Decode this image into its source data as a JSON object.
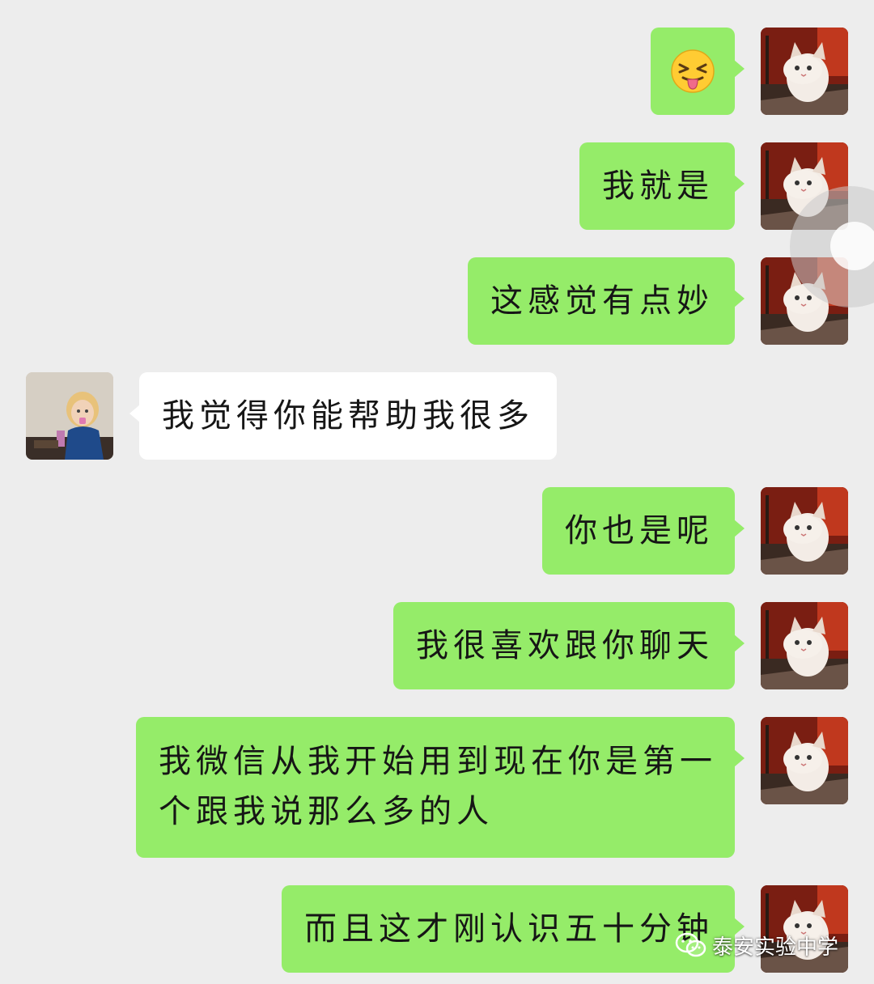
{
  "colors": {
    "background": "#ededed",
    "my_bubble": "#95ec69",
    "their_bubble": "#ffffff",
    "text": "#161616"
  },
  "messages": [
    {
      "sender": "me",
      "type": "emoji",
      "icon": "squinting-face-with-tongue-icon"
    },
    {
      "sender": "me",
      "text": "我就是"
    },
    {
      "sender": "me",
      "text": "这感觉有点妙"
    },
    {
      "sender": "them",
      "text": "我觉得你能帮助我很多"
    },
    {
      "sender": "me",
      "text": "你也是呢"
    },
    {
      "sender": "me",
      "text": "我很喜欢跟你聊天"
    },
    {
      "sender": "me",
      "text_line1": "我微信从我开始用到现在你是第一",
      "text_line2": "个跟我说那么多的人"
    },
    {
      "sender": "me",
      "text": "而且这才刚认识五十分钟"
    }
  ],
  "watermark": {
    "icon": "wechat-icon",
    "text": "泰安实验中学"
  }
}
